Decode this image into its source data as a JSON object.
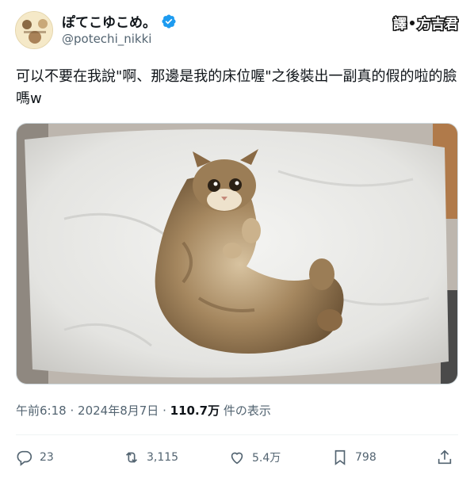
{
  "author": {
    "display_name": "ぽてこゆこめ。",
    "handle": "@potechi_nikki",
    "verified_badge_color": "#1d9bf0",
    "avatar_icon": "cat-avatar-icon"
  },
  "watermark": {
    "left": "譯",
    "right": "方吉君"
  },
  "tweet": {
    "text": "可以不要在我說\"啊、那邊是我的床位喔\"之後裝出一副真的假的啦的臉嗎w"
  },
  "media": {
    "image_alt": "cat-lying-on-white-pillow-photo"
  },
  "meta": {
    "time": "午前6:18",
    "separator": "·",
    "date": "2024年8月7日",
    "views_count": "110.7万",
    "views_label": "件の表示"
  },
  "actions": {
    "replies": "23",
    "reposts": "3,115",
    "likes": "5.4万",
    "bookmarks": "798"
  },
  "colors": {
    "text_primary": "#0f1419",
    "text_secondary": "#536471",
    "divider": "#eff3f4"
  }
}
